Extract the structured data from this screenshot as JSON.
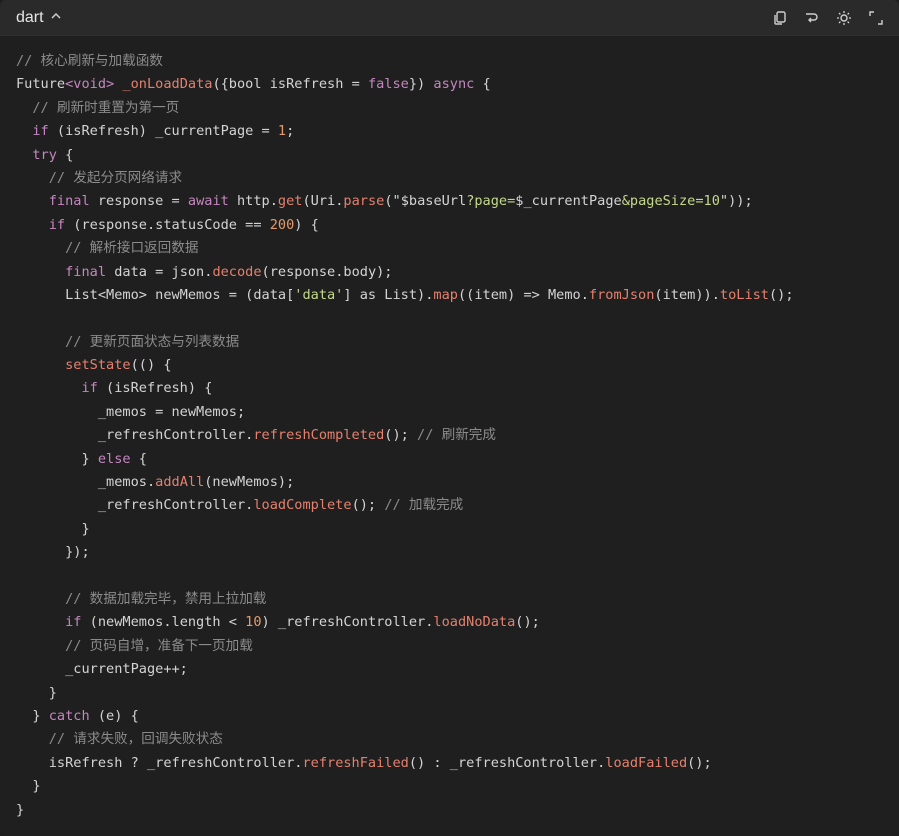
{
  "header": {
    "language": "dart"
  },
  "code": {
    "lines": [
      [
        {
          "t": "c",
          "v": "// 核心刷新与加载函数"
        }
      ],
      [
        {
          "t": "t",
          "v": "Future"
        },
        {
          "t": "k",
          "v": "<void>"
        },
        {
          "t": "t",
          "v": " "
        },
        {
          "t": "f",
          "v": "_onLoadData"
        },
        {
          "t": "t",
          "v": "({bool isRefresh = "
        },
        {
          "t": "k",
          "v": "false"
        },
        {
          "t": "t",
          "v": "}) "
        },
        {
          "t": "k",
          "v": "async"
        },
        {
          "t": "t",
          "v": " {"
        }
      ],
      [
        {
          "t": "c",
          "v": "  // 刷新时重置为第一页"
        }
      ],
      [
        {
          "t": "k",
          "v": "  if"
        },
        {
          "t": "t",
          "v": " (isRefresh) _currentPage = "
        },
        {
          "t": "n",
          "v": "1"
        },
        {
          "t": "t",
          "v": ";"
        }
      ],
      [
        {
          "t": "k",
          "v": "  try"
        },
        {
          "t": "t",
          "v": " {"
        }
      ],
      [
        {
          "t": "c",
          "v": "    // 发起分页网络请求"
        }
      ],
      [
        {
          "t": "k",
          "v": "    final"
        },
        {
          "t": "t",
          "v": " response = "
        },
        {
          "t": "k",
          "v": "await"
        },
        {
          "t": "t",
          "v": " http."
        },
        {
          "t": "f",
          "v": "get"
        },
        {
          "t": "t",
          "v": "(Uri."
        },
        {
          "t": "f",
          "v": "parse"
        },
        {
          "t": "t",
          "v": "(\""
        },
        {
          "t": "t",
          "v": "$baseUrl"
        },
        {
          "t": "s",
          "v": "?page="
        },
        {
          "t": "t",
          "v": "$_currentPage"
        },
        {
          "t": "s",
          "v": "&pageSize=10"
        },
        {
          "t": "t",
          "v": "\"));"
        }
      ],
      [
        {
          "t": "k",
          "v": "    if"
        },
        {
          "t": "t",
          "v": " (response.statusCode == "
        },
        {
          "t": "n",
          "v": "200"
        },
        {
          "t": "t",
          "v": ") {"
        }
      ],
      [
        {
          "t": "c",
          "v": "      // 解析接口返回数据"
        }
      ],
      [
        {
          "t": "k",
          "v": "      final"
        },
        {
          "t": "t",
          "v": " data = json."
        },
        {
          "t": "f",
          "v": "decode"
        },
        {
          "t": "t",
          "v": "(response.body);"
        }
      ],
      [
        {
          "t": "t",
          "v": "      List"
        },
        {
          "t": "t",
          "v": "<Memo> newMemos = (data["
        },
        {
          "t": "s",
          "v": "'data'"
        },
        {
          "t": "t",
          "v": "] as List)."
        },
        {
          "t": "f",
          "v": "map"
        },
        {
          "t": "t",
          "v": "((item) => Memo."
        },
        {
          "t": "f",
          "v": "fromJson"
        },
        {
          "t": "t",
          "v": "(item))."
        },
        {
          "t": "f",
          "v": "toList"
        },
        {
          "t": "t",
          "v": "();"
        }
      ],
      [
        {
          "t": "t",
          "v": ""
        }
      ],
      [
        {
          "t": "c",
          "v": "      // 更新页面状态与列表数据"
        }
      ],
      [
        {
          "t": "f",
          "v": "      setState"
        },
        {
          "t": "t",
          "v": "(() {"
        }
      ],
      [
        {
          "t": "k",
          "v": "        if"
        },
        {
          "t": "t",
          "v": " (isRefresh) {"
        }
      ],
      [
        {
          "t": "t",
          "v": "          _memos = newMemos;"
        }
      ],
      [
        {
          "t": "t",
          "v": "          _refreshController."
        },
        {
          "t": "f",
          "v": "refreshCompleted"
        },
        {
          "t": "t",
          "v": "(); "
        },
        {
          "t": "c",
          "v": "// 刷新完成"
        }
      ],
      [
        {
          "t": "t",
          "v": "        } "
        },
        {
          "t": "k",
          "v": "else"
        },
        {
          "t": "t",
          "v": " {"
        }
      ],
      [
        {
          "t": "t",
          "v": "          _memos."
        },
        {
          "t": "f",
          "v": "addAll"
        },
        {
          "t": "t",
          "v": "(newMemos);"
        }
      ],
      [
        {
          "t": "t",
          "v": "          _refreshController."
        },
        {
          "t": "f",
          "v": "loadComplete"
        },
        {
          "t": "t",
          "v": "(); "
        },
        {
          "t": "c",
          "v": "// 加载完成"
        }
      ],
      [
        {
          "t": "t",
          "v": "        }"
        }
      ],
      [
        {
          "t": "t",
          "v": "      });"
        }
      ],
      [
        {
          "t": "t",
          "v": ""
        }
      ],
      [
        {
          "t": "c",
          "v": "      // 数据加载完毕，禁用上拉加载"
        }
      ],
      [
        {
          "t": "k",
          "v": "      if"
        },
        {
          "t": "t",
          "v": " (newMemos.length < "
        },
        {
          "t": "n",
          "v": "10"
        },
        {
          "t": "t",
          "v": ") _refreshController."
        },
        {
          "t": "f",
          "v": "loadNoData"
        },
        {
          "t": "t",
          "v": "();"
        }
      ],
      [
        {
          "t": "c",
          "v": "      // 页码自增，准备下一页加载"
        }
      ],
      [
        {
          "t": "t",
          "v": "      _currentPage++;"
        }
      ],
      [
        {
          "t": "t",
          "v": "    }"
        }
      ],
      [
        {
          "t": "t",
          "v": "  } "
        },
        {
          "t": "k",
          "v": "catch"
        },
        {
          "t": "t",
          "v": " (e) {"
        }
      ],
      [
        {
          "t": "c",
          "v": "    // 请求失败，回调失败状态"
        }
      ],
      [
        {
          "t": "t",
          "v": "    isRefresh ? _refreshController."
        },
        {
          "t": "f",
          "v": "refreshFailed"
        },
        {
          "t": "t",
          "v": "() : _refreshController."
        },
        {
          "t": "f",
          "v": "loadFailed"
        },
        {
          "t": "t",
          "v": "();"
        }
      ],
      [
        {
          "t": "t",
          "v": "  }"
        }
      ],
      [
        {
          "t": "t",
          "v": "}"
        }
      ]
    ]
  }
}
